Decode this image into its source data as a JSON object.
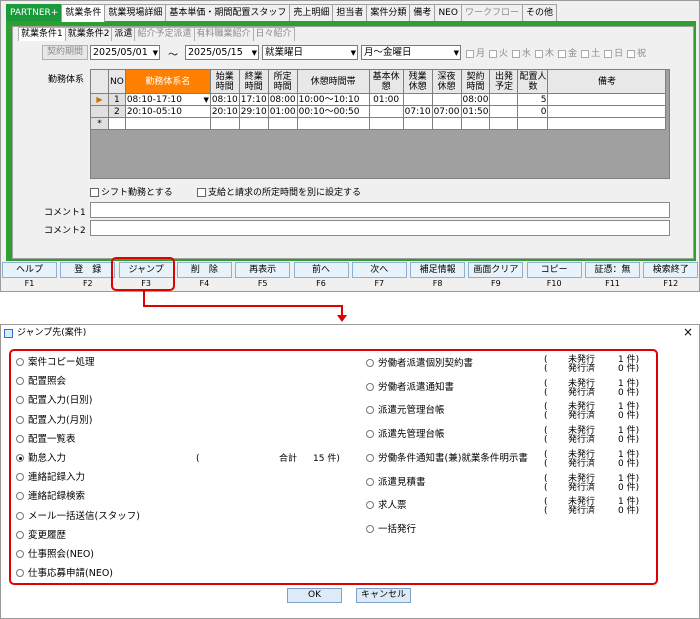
{
  "tabs": [
    "PARTNER+",
    "就業条件",
    "就業現場詳細",
    "基本単価・期間配置スタッフ",
    "売上明細",
    "担当者",
    "案件分類",
    "備考",
    "NEO",
    "ワークフロー",
    "その他"
  ],
  "subtabs": [
    "就業条件1",
    "就業条件2",
    "派遣",
    "紹介予定派遣",
    "有料職業紹介",
    "日々紹介"
  ],
  "form": {
    "period_btn": "契約期間",
    "date_from": "2025/05/01",
    "tilde": "～",
    "date_to": "2025/05/15",
    "workday_type": "就業曜日",
    "day_range": "月～金曜日",
    "days": [
      "月",
      "火",
      "水",
      "木",
      "金",
      "土",
      "日",
      "祝"
    ],
    "work_system_label": "勤務体系"
  },
  "grid": {
    "headers": [
      "NO",
      "勤務体系名",
      "始業時間",
      "終業時間",
      "所定時間",
      "休憩時間帯",
      "基本休憩",
      "残業休憩",
      "深夜休憩",
      "契約時間",
      "出発予定",
      "配置人数",
      "備考"
    ],
    "rows": [
      [
        "1",
        "08:10-17:10",
        "08:10",
        "17:10",
        "08:00",
        "10:00～10:10",
        "01:00",
        "",
        "",
        "08:00",
        "",
        "5",
        ""
      ],
      [
        "2",
        "20:10-05:10",
        "20:10",
        "29:10",
        "01:00",
        "00:10～00:50",
        "",
        "07:10",
        "07:00",
        "01:50",
        "",
        "0",
        ""
      ]
    ],
    "new_row": "*"
  },
  "checks": {
    "shift": "シフト勤務とする",
    "separate": "支給と請求の所定時間を別に設定する"
  },
  "comments": [
    "コメント1",
    "コメント2"
  ],
  "fkeys": [
    {
      "label": "ヘルプ",
      "key": "F1"
    },
    {
      "label": "登　録",
      "key": "F2"
    },
    {
      "label": "ジャンプ",
      "key": "F3"
    },
    {
      "label": "削　除",
      "key": "F4"
    },
    {
      "label": "再表示",
      "key": "F5"
    },
    {
      "label": "前へ",
      "key": "F6"
    },
    {
      "label": "次へ",
      "key": "F7"
    },
    {
      "label": "補足情報",
      "key": "F8"
    },
    {
      "label": "画面クリア",
      "key": "F9"
    },
    {
      "label": "コピー",
      "key": "F10"
    },
    {
      "label": "証憑：無",
      "key": "F11"
    },
    {
      "label": "検索終了",
      "key": "F12"
    }
  ],
  "dialog": {
    "title": "ジャンプ先(案件)",
    "close": "×",
    "left": [
      "案件コピー処理",
      "配置照会",
      "配置入力(日別)",
      "配置入力(月別)",
      "配置一覧表",
      "勤怠入力",
      "連絡記録入力",
      "連絡記録検索",
      "メール一括送信(スタッフ)",
      "変更履歴",
      "仕事照会(NEO)",
      "仕事応募申請(NEO)"
    ],
    "selected": "勤怠入力",
    "total": {
      "open": "(",
      "label": "合計",
      "value": "15 件)"
    },
    "right": [
      "労働者派遣個別契約書",
      "労働者派遣通知書",
      "派遣元管理台帳",
      "派遣先管理台帳",
      "労働条件通知書(兼)就業条件明示書",
      "派遣見積書",
      "求人票",
      "一括発行"
    ],
    "status": {
      "unissued": "未発行",
      "issued": "発行済",
      "unissued_n": "1 件)",
      "issued_n": "0 件)",
      "paren": "("
    },
    "ok": "OK",
    "cancel": "キャンセル"
  }
}
